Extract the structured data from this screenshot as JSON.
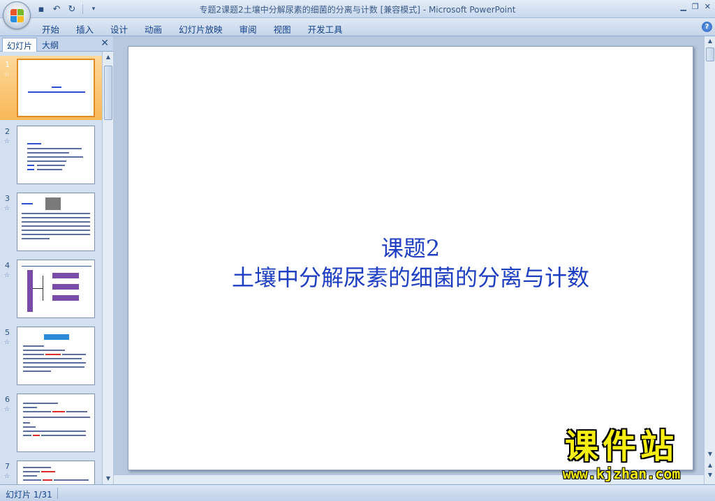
{
  "window": {
    "title": "专题2课题2土壤中分解尿素的细菌的分离与计数 [兼容模式] - Microsoft PowerPoint"
  },
  "ribbon": {
    "tabs": [
      "开始",
      "插入",
      "设计",
      "动画",
      "幻灯片放映",
      "审阅",
      "视图",
      "开发工具"
    ]
  },
  "left_pane": {
    "tab_slides": "幻灯片",
    "tab_outline": "大纲",
    "close": "✕",
    "slides": [
      {
        "number": "1",
        "selected": true
      },
      {
        "number": "2"
      },
      {
        "number": "3"
      },
      {
        "number": "4"
      },
      {
        "number": "5"
      },
      {
        "number": "6"
      },
      {
        "number": "7"
      }
    ]
  },
  "slide": {
    "title_line1": "课题2",
    "title_line2": "土壤中分解尿素的细菌的分离与计数"
  },
  "watermark": {
    "title": "课件站",
    "url": "www.kjzhan.com"
  },
  "status_bar": {
    "slide_indicator": "幻灯片 1/31"
  },
  "colors": {
    "slide_title": "#1f3fc2",
    "selected_thumb": "#f8b857",
    "watermark": "#f6ee10"
  }
}
